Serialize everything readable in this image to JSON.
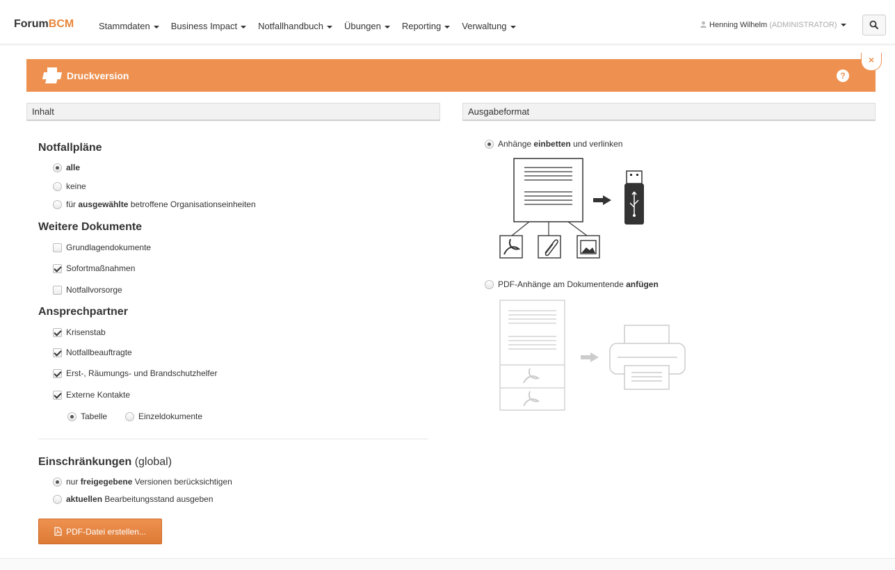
{
  "app": {
    "brand_prefix": "Forum",
    "brand_suffix": "BCM",
    "accent_color": "#ee9150"
  },
  "nav": {
    "items": [
      {
        "label": "Stammdaten"
      },
      {
        "label": "Business Impact"
      },
      {
        "label": "Notfallhandbuch"
      },
      {
        "label": "Übungen"
      },
      {
        "label": "Reporting"
      },
      {
        "label": "Verwaltung"
      }
    ],
    "user_name": "Henning Wilhelm",
    "user_role": "(ADMINISTRATOR)",
    "search_icon": "search-icon"
  },
  "panel": {
    "title": "Druckversion",
    "icon": "printer-icon",
    "help_label": "?",
    "close_label": "×"
  },
  "left": {
    "section_title": "Inhalt",
    "notfallplaene": {
      "heading": "Notfallpläne",
      "options": [
        {
          "label_bold": "alle",
          "label_rest": "",
          "checked": true
        },
        {
          "label_pre": "keine",
          "checked": false
        },
        {
          "label_pre": "für ",
          "label_bold": "ausgewählte",
          "label_rest": " betroffene Organisationseinheiten",
          "checked": false
        }
      ]
    },
    "weitere": {
      "heading": "Weitere Dokumente",
      "items": [
        {
          "label": "Grundlagendokumente",
          "checked": false
        },
        {
          "label": "Sofortmaßnahmen",
          "checked": true
        },
        {
          "label": "Notfallvorsorge",
          "checked": false
        }
      ]
    },
    "ansprech": {
      "heading": "Ansprechpartner",
      "items": [
        {
          "label": "Krisenstab",
          "checked": true
        },
        {
          "label": "Notfallbeauftragte",
          "checked": true
        },
        {
          "label": "Erst-, Räumungs- und Brandschutzhelfer",
          "checked": true
        },
        {
          "label": "Externe Kontakte",
          "checked": true
        }
      ],
      "format_options": [
        {
          "label": "Tabelle",
          "checked": true
        },
        {
          "label": "Einzeldokumente",
          "checked": false
        }
      ]
    },
    "einschraenkungen": {
      "heading": "Einschränkungen",
      "heading_light": "(global)",
      "options": [
        {
          "pre": "nur ",
          "bold": "freigegebene",
          "rest": " Versionen berücksichtigen",
          "checked": true
        },
        {
          "pre": "",
          "bold": "aktuellen",
          "rest": " Bearbeitungsstand ausgeben",
          "checked": false
        }
      ]
    },
    "pdf_button": "PDF-Datei erstellen..."
  },
  "right": {
    "section_title": "Ausgabeformat",
    "options": [
      {
        "pre": "Anhänge ",
        "bold": "einbetten",
        "rest": " und verlinken",
        "checked": true
      },
      {
        "pre": "PDF-Anhänge am Dokumentende ",
        "bold": "anfügen",
        "rest": "",
        "checked": false
      }
    ]
  }
}
